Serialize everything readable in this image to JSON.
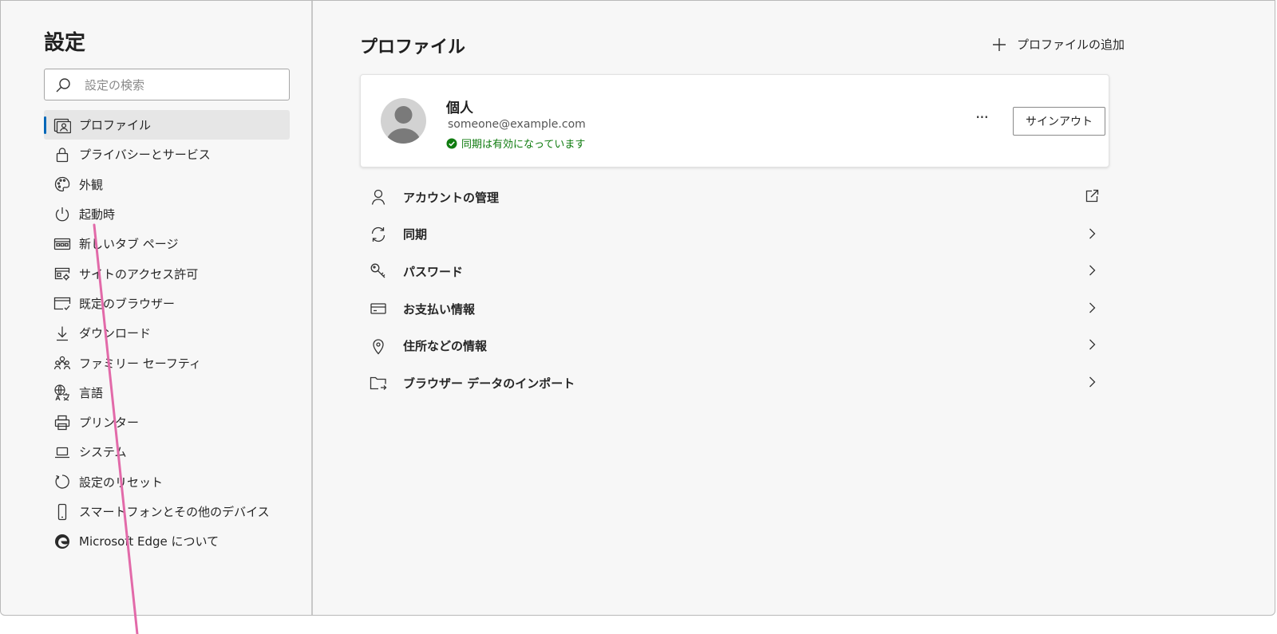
{
  "sidebar": {
    "title": "設定",
    "search": {
      "placeholder": "設定の検索",
      "value": "",
      "icon": "search-icon"
    },
    "items": [
      {
        "label": "プロファイル",
        "icon": "profile-icon",
        "active": true
      },
      {
        "label": "プライバシーとサービス",
        "icon": "lock-icon"
      },
      {
        "label": "外観",
        "icon": "palette-icon"
      },
      {
        "label": "起動時",
        "icon": "power-icon"
      },
      {
        "label": "新しいタブ ページ",
        "icon": "new-tab-page-icon"
      },
      {
        "label": "サイトのアクセス許可",
        "icon": "site-permissions-icon"
      },
      {
        "label": "既定のブラウザー",
        "icon": "default-browser-icon"
      },
      {
        "label": "ダウンロード",
        "icon": "download-icon"
      },
      {
        "label": "ファミリー セーフティ",
        "icon": "family-icon"
      },
      {
        "label": "言語",
        "icon": "language-icon"
      },
      {
        "label": "プリンター",
        "icon": "printer-icon"
      },
      {
        "label": "システム",
        "icon": "laptop-icon"
      },
      {
        "label": "設定のリセット",
        "icon": "reset-icon"
      },
      {
        "label": "スマートフォンとその他のデバイス",
        "icon": "phone-icon"
      },
      {
        "label": "Microsoft Edge について",
        "icon": "edge-logo-icon"
      }
    ]
  },
  "main": {
    "title": "プロファイル",
    "add_profile_label": "プロファイルの追加",
    "profile": {
      "name": "個人",
      "email": "someone@example.com",
      "sync_status": "同期は有効になっています",
      "more_label": "···",
      "sign_out_label": "サインアウト"
    },
    "rows": [
      {
        "label": "アカウントの管理",
        "icon": "person-icon",
        "trail": "external-link-icon"
      },
      {
        "label": "同期",
        "icon": "sync-icon",
        "trail": "chevron-right-icon"
      },
      {
        "label": "パスワード",
        "icon": "key-icon",
        "trail": "chevron-right-icon"
      },
      {
        "label": "お支払い情報",
        "icon": "credit-card-icon",
        "trail": "chevron-right-icon"
      },
      {
        "label": "住所などの情報",
        "icon": "location-icon",
        "trail": "chevron-right-icon"
      },
      {
        "label": "ブラウザー データのインポート",
        "icon": "import-folder-icon",
        "trail": "chevron-right-icon"
      }
    ]
  },
  "colors": {
    "accent": "#0067b8",
    "sync_ok": "#107c10",
    "annotation_line": "#e26aa9",
    "background": "#f7f7f7"
  }
}
